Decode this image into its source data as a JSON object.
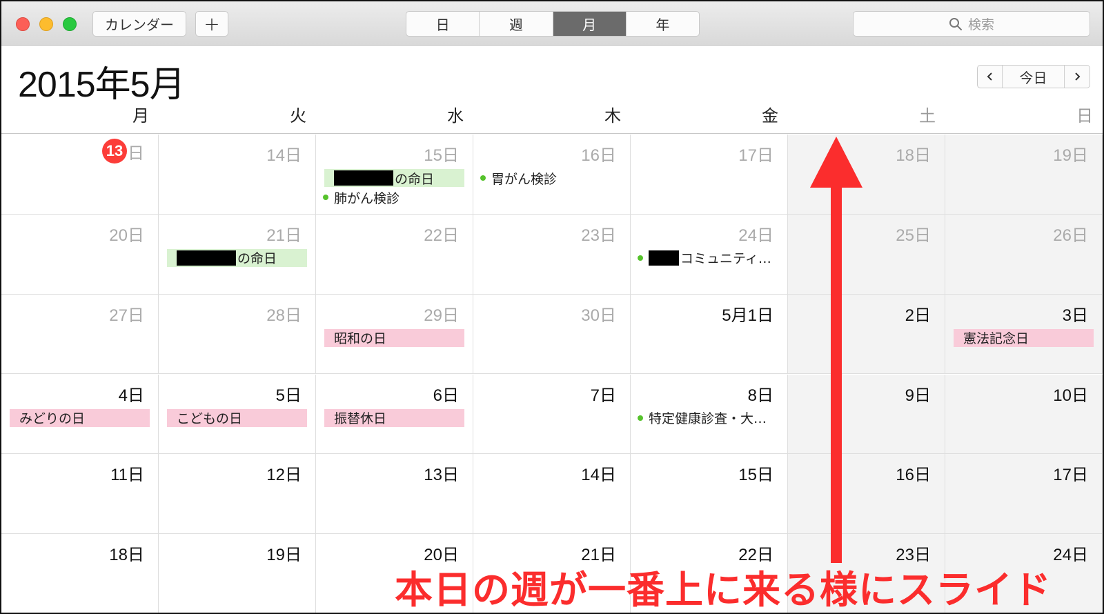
{
  "toolbar": {
    "calendars_label": "カレンダー",
    "add_label": "+",
    "views": [
      {
        "label": "日",
        "active": false
      },
      {
        "label": "週",
        "active": false
      },
      {
        "label": "月",
        "active": true
      },
      {
        "label": "年",
        "active": false
      }
    ],
    "search_placeholder": "検索"
  },
  "header": {
    "title": "2015年5月",
    "nav": {
      "prev_icon": "chevron-left-icon",
      "today_label": "今日",
      "next_icon": "chevron-right-icon"
    }
  },
  "weekdays": [
    "月",
    "火",
    "水",
    "木",
    "金",
    "土",
    "日"
  ],
  "weeks": [
    [
      {
        "day": "13",
        "suffix": "日",
        "today": true
      },
      {
        "day": "14日"
      },
      {
        "day": "15日",
        "events": [
          {
            "kind": "bar",
            "color": "green",
            "redacted": true,
            "text": "の命日"
          },
          {
            "kind": "dot",
            "text": "肺がん検診"
          }
        ]
      },
      {
        "day": "16日",
        "events": [
          {
            "kind": "dot",
            "text": "胃がん検診"
          }
        ]
      },
      {
        "day": "17日"
      },
      {
        "day": "18日"
      },
      {
        "day": "19日"
      }
    ],
    [
      {
        "day": "20日"
      },
      {
        "day": "21日",
        "events": [
          {
            "kind": "bar",
            "color": "green",
            "redacted": true,
            "text": "の命日"
          }
        ]
      },
      {
        "day": "22日"
      },
      {
        "day": "23日"
      },
      {
        "day": "24日",
        "events": [
          {
            "kind": "dot",
            "redacted_short": true,
            "text": "コミュニティ…"
          }
        ]
      },
      {
        "day": "25日"
      },
      {
        "day": "26日"
      }
    ],
    [
      {
        "day": "27日"
      },
      {
        "day": "28日"
      },
      {
        "day": "29日",
        "events": [
          {
            "kind": "bar",
            "color": "pink",
            "text": "昭和の日"
          }
        ]
      },
      {
        "day": "30日"
      },
      {
        "day": "5月1日",
        "current": true
      },
      {
        "day": "2日",
        "current": true
      },
      {
        "day": "3日",
        "current": true,
        "events": [
          {
            "kind": "bar",
            "color": "pink",
            "text": "憲法記念日"
          }
        ]
      }
    ],
    [
      {
        "day": "4日",
        "current": true,
        "events": [
          {
            "kind": "bar",
            "color": "pink",
            "text": "みどりの日"
          }
        ]
      },
      {
        "day": "5日",
        "current": true,
        "events": [
          {
            "kind": "bar",
            "color": "pink",
            "text": "こどもの日"
          }
        ]
      },
      {
        "day": "6日",
        "current": true,
        "events": [
          {
            "kind": "bar",
            "color": "pink",
            "text": "振替休日"
          }
        ]
      },
      {
        "day": "7日",
        "current": true
      },
      {
        "day": "8日",
        "current": true,
        "events": [
          {
            "kind": "dot",
            "text": "特定健康診査・大…"
          }
        ]
      },
      {
        "day": "9日",
        "current": true
      },
      {
        "day": "10日",
        "current": true
      }
    ],
    [
      {
        "day": "11日",
        "current": true
      },
      {
        "day": "12日",
        "current": true
      },
      {
        "day": "13日",
        "current": true
      },
      {
        "day": "14日",
        "current": true
      },
      {
        "day": "15日",
        "current": true
      },
      {
        "day": "16日",
        "current": true
      },
      {
        "day": "17日",
        "current": true
      }
    ],
    [
      {
        "day": "18日",
        "current": true
      },
      {
        "day": "19日",
        "current": true
      },
      {
        "day": "20日",
        "current": true
      },
      {
        "day": "21日",
        "current": true
      },
      {
        "day": "22日",
        "current": true
      },
      {
        "day": "23日",
        "current": true
      },
      {
        "day": "24日",
        "current": true
      }
    ]
  ],
  "annotation": {
    "text": "本日の週が一番上に来る様にスライド",
    "color": "#fb2d2d"
  },
  "colors": {
    "today": "#fc3d39",
    "event_green": "#d9f2d1",
    "event_pink": "#f9cbd9",
    "dot_green": "#56c22c"
  }
}
